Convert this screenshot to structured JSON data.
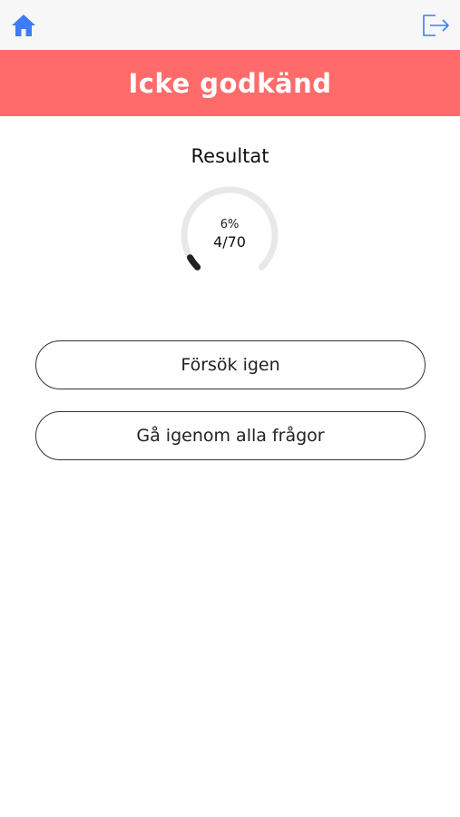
{
  "topbar": {
    "home_icon": "home-icon",
    "logout_icon": "logout-icon",
    "accent_color": "#3d7cf5"
  },
  "banner": {
    "title": "Icke godkänd",
    "background_color": "#ff6b6b"
  },
  "result": {
    "label": "Resultat",
    "percent_text": "6%",
    "score_text": "4/70",
    "progress_fraction": 0.057
  },
  "actions": {
    "retry_label": "Försök igen",
    "review_label": "Gå igenom alla frågor"
  }
}
